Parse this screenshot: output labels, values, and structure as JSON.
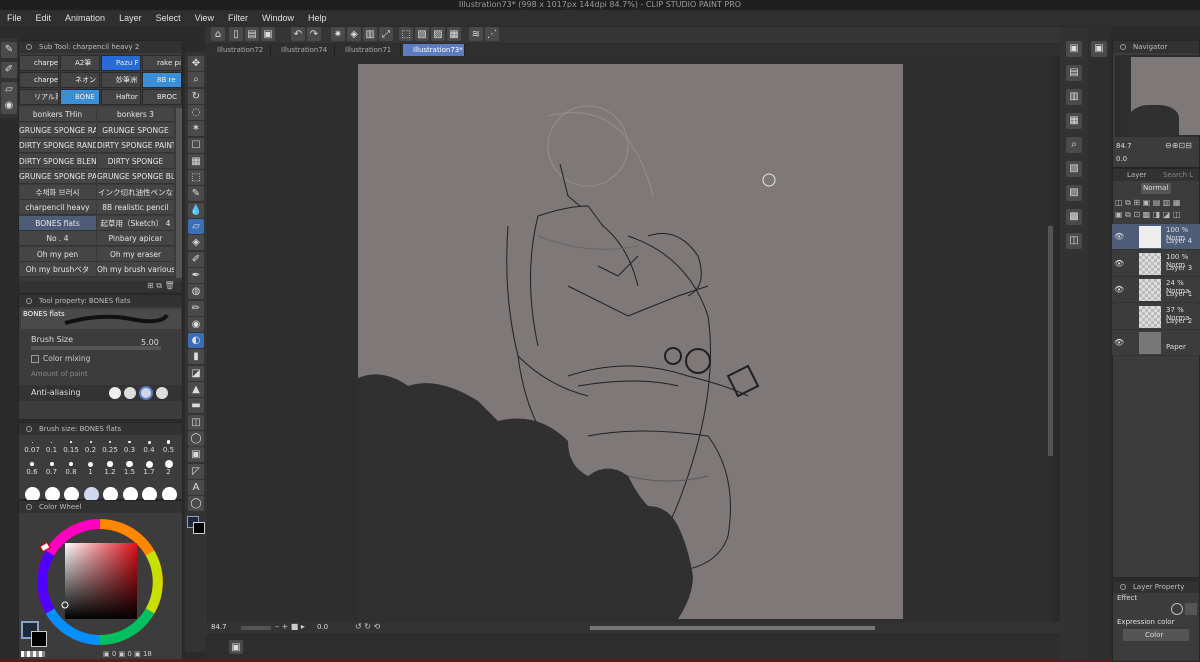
{
  "window": {
    "title": "Illustration73* (998 x 1017px 144dpi 84.7%)  - CLIP STUDIO PAINT PRO"
  },
  "menu": [
    "File",
    "Edit",
    "Animation",
    "Layer",
    "Select",
    "View",
    "Filter",
    "Window",
    "Help"
  ],
  "doc_tabs": [
    "Illustration72",
    "Illustration74",
    "Illustration71",
    "Illustration73*"
  ],
  "subtool": {
    "header": "Sub Tool: charpencil heavy 2",
    "grid": [
      [
        "charpe",
        "A2筆",
        "Pazu F",
        "rake pa"
      ],
      [
        "charpe",
        "ネオン",
        "妙筆洲",
        "8B re"
      ],
      [
        "リアル系",
        "BONE",
        "Haftor",
        "BROC"
      ]
    ],
    "brushes": [
      [
        "bonkers THin",
        "bonkers 3"
      ],
      [
        "GRUNGE SPONGE RA",
        "GRUNGE SPONGE"
      ],
      [
        "DIRTY SPONGE RAND",
        "DIRTY SPONGE PAINT"
      ],
      [
        "DIRTY SPONGE BLEN",
        "DIRTY SPONGE"
      ],
      [
        "GRUNGE SPONGE PA",
        "GRUNGE SPONGE BLE"
      ],
      [
        "수채화 브러시",
        "インク切れ油性ペンな"
      ],
      [
        "charpencil heavy",
        "8B realistic pencil"
      ],
      [
        "BONES flats",
        "起草用（Sketch） 4"
      ],
      [
        "No . 4",
        "Pinbary apicar"
      ],
      [
        "Oh my pen",
        "Oh my eraser"
      ],
      [
        "Oh my brushベタ",
        "Oh my brush various"
      ]
    ]
  },
  "toolprop": {
    "header": "Tool property: BONES flats",
    "preview_label": "BONES flats",
    "brush_size_label": "Brush Size",
    "brush_size_value": "5.00",
    "color_mixing": "Color mixing",
    "amount_label": "Amount of paint",
    "anti_alias": "Anti-aliasing"
  },
  "brushsize": {
    "header": "Brush size: BONES flats",
    "row1": [
      "0.07",
      "0.1",
      "0.15",
      "0.2",
      "0.25",
      "0.3",
      "0.4",
      "0.5"
    ],
    "row2": [
      "0.6",
      "0.7",
      "0.8",
      "1",
      "1.2",
      "1.5",
      "1.7",
      "2"
    ]
  },
  "colorwheel": {
    "header": "Color Wheel",
    "readout": [
      "0",
      "0",
      "18"
    ]
  },
  "canvas": {
    "zoom": "84.7",
    "angle": "0.0"
  },
  "navigator": {
    "header": "Navigator",
    "zoom": "84.7",
    "angle": "0.0"
  },
  "layers": {
    "tab": "Layer",
    "search": "Search L",
    "blend": "Normal",
    "items": [
      {
        "pct": "100 % Norm",
        "name": "Layer 4",
        "visible": true
      },
      {
        "pct": "100 % Norm",
        "name": "Layer 3",
        "visible": true
      },
      {
        "pct": "24 % Norma",
        "name": "Layer 1",
        "visible": true
      },
      {
        "pct": "37 % Norma",
        "name": "Layer 2",
        "visible": false
      },
      {
        "pct": "",
        "name": "Paper",
        "visible": true
      }
    ]
  },
  "layerprop": {
    "header": "Layer Property",
    "effect": "Effect",
    "expression": "Expression color",
    "expression_value": "Color"
  },
  "colors": {
    "accent": "#5d7cc0",
    "wheel_main": "#000000",
    "wheel_sub": "#e0e0e0"
  }
}
